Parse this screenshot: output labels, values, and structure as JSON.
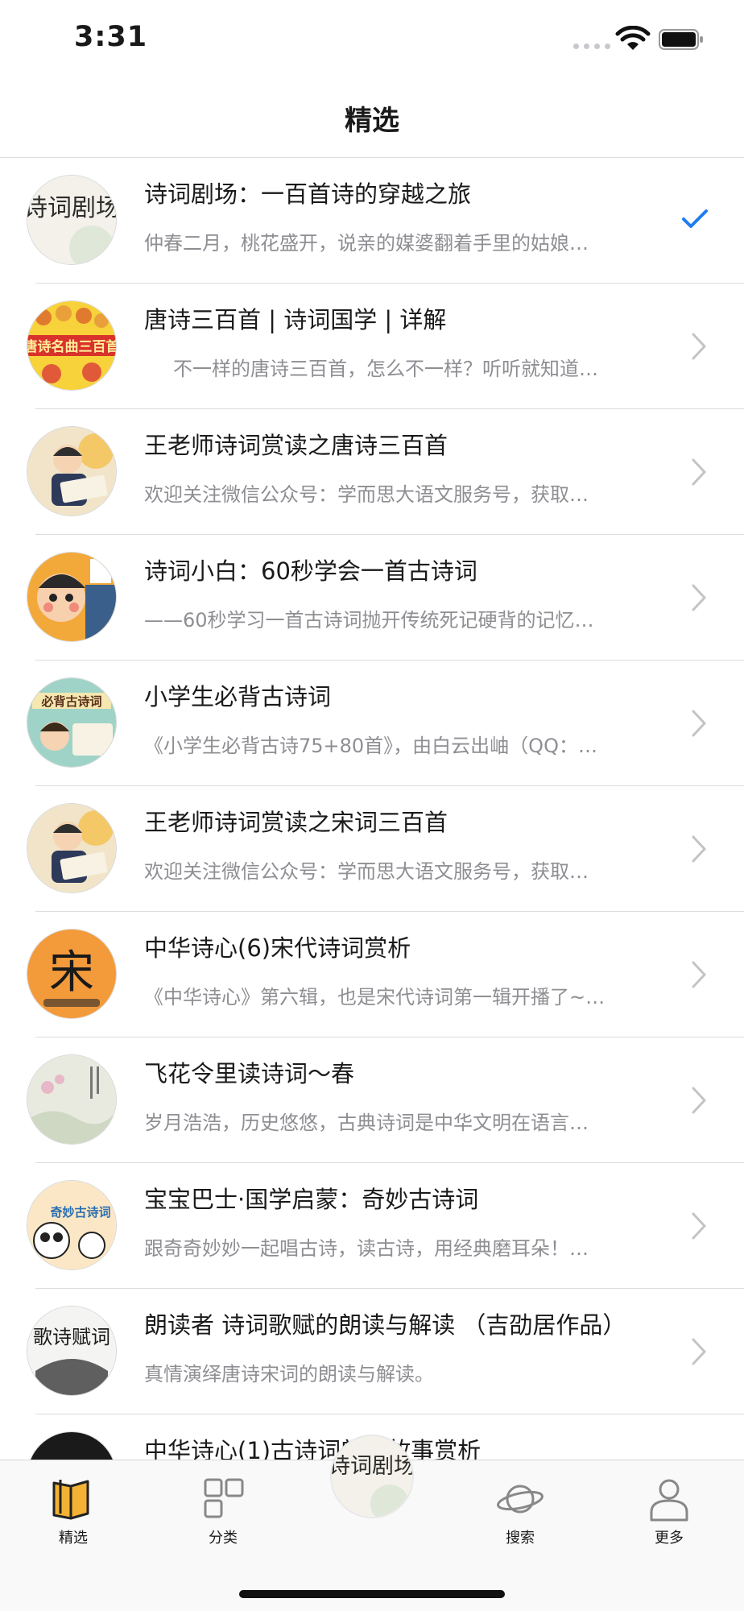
{
  "status_bar": {
    "time": "3:31"
  },
  "header": {
    "title": "精选"
  },
  "list": [
    {
      "title": "诗词剧场：一百首诗的穿越之旅",
      "subtitle": "仲春二月，桃花盛开，说亲的媒婆翻着手里的姑娘…",
      "selected": true,
      "avatar_text": "诗词剧场",
      "avatar_icon": "poetry-theater-logo"
    },
    {
      "title": "唐诗三百首 | 诗词国学 | 详解",
      "subtitle": "不一样的唐诗三百首，怎么不一样？听听就知道…",
      "selected": false,
      "avatar_text": "唐诗名曲三百首",
      "avatar_icon": "tang-poems-cover"
    },
    {
      "title": "王老师诗词赏读之唐诗三百首",
      "subtitle": "欢迎关注微信公众号：学而思大语文服务号，获取…",
      "selected": false,
      "avatar_icon": "teacher-wang-cover"
    },
    {
      "title": "诗词小白：60秒学会一首古诗词",
      "subtitle": "——60秒学习一首古诗词抛开传统死记硬背的记忆…",
      "selected": false,
      "avatar_icon": "poetry-beginner-cover"
    },
    {
      "title": "小学生必背古诗词",
      "subtitle": "《小学生必背古诗75+80首》，由白云出岫（QQ：…",
      "selected": false,
      "avatar_text": "必背古诗词",
      "avatar_icon": "pupil-poems-cover"
    },
    {
      "title": "王老师诗词赏读之宋词三百首",
      "subtitle": "欢迎关注微信公众号：学而思大语文服务号，获取…",
      "selected": false,
      "avatar_icon": "teacher-wang-cover"
    },
    {
      "title": "中华诗心(6)宋代诗词赏析",
      "subtitle": "《中华诗心》第六辑，也是宋代诗词第一辑开播了~…",
      "selected": false,
      "avatar_text": "宋",
      "avatar_icon": "song-poetry-cover"
    },
    {
      "title": "飞花令里读诗词～春",
      "subtitle": "岁月浩浩，历史悠悠，古典诗词是中华文明在语言…",
      "selected": false,
      "avatar_icon": "feihualing-cover"
    },
    {
      "title": "宝宝巴士·国学启蒙：奇妙古诗词",
      "subtitle": "跟奇奇妙妙一起唱古诗，读古诗，用经典磨耳朵！…",
      "selected": false,
      "avatar_text": "奇妙古诗词",
      "avatar_icon": "babybus-cover"
    },
    {
      "title": "朗读者 诗词歌赋的朗读与解读 （吉劭居作品）",
      "subtitle": "真情演绎唐诗宋词的朗读与解读。",
      "selected": false,
      "avatar_text": "歌诗赋词",
      "avatar_icon": "reader-cover"
    },
    {
      "title": "中华诗心(1)古诗词朗诵故事赏析",
      "subtitle": "",
      "selected": false,
      "avatar_icon": "chinese-poetry-cover"
    }
  ],
  "tab_bar": {
    "items": [
      {
        "label": "精选",
        "icon": "book-icon",
        "active": true
      },
      {
        "label": "分类",
        "icon": "grid-icon",
        "active": false
      },
      {
        "label": "",
        "icon": "poetry-theater-logo",
        "active": false
      },
      {
        "label": "搜索",
        "icon": "planet-icon",
        "active": false
      },
      {
        "label": "更多",
        "icon": "person-icon",
        "active": false
      }
    ],
    "center_logo_text": "诗词剧场"
  },
  "colors": {
    "accent": "#1e7ef0",
    "secondary_text": "#8e8e93",
    "separator": "#dcdcdc",
    "book_icon": "#f3b233"
  }
}
